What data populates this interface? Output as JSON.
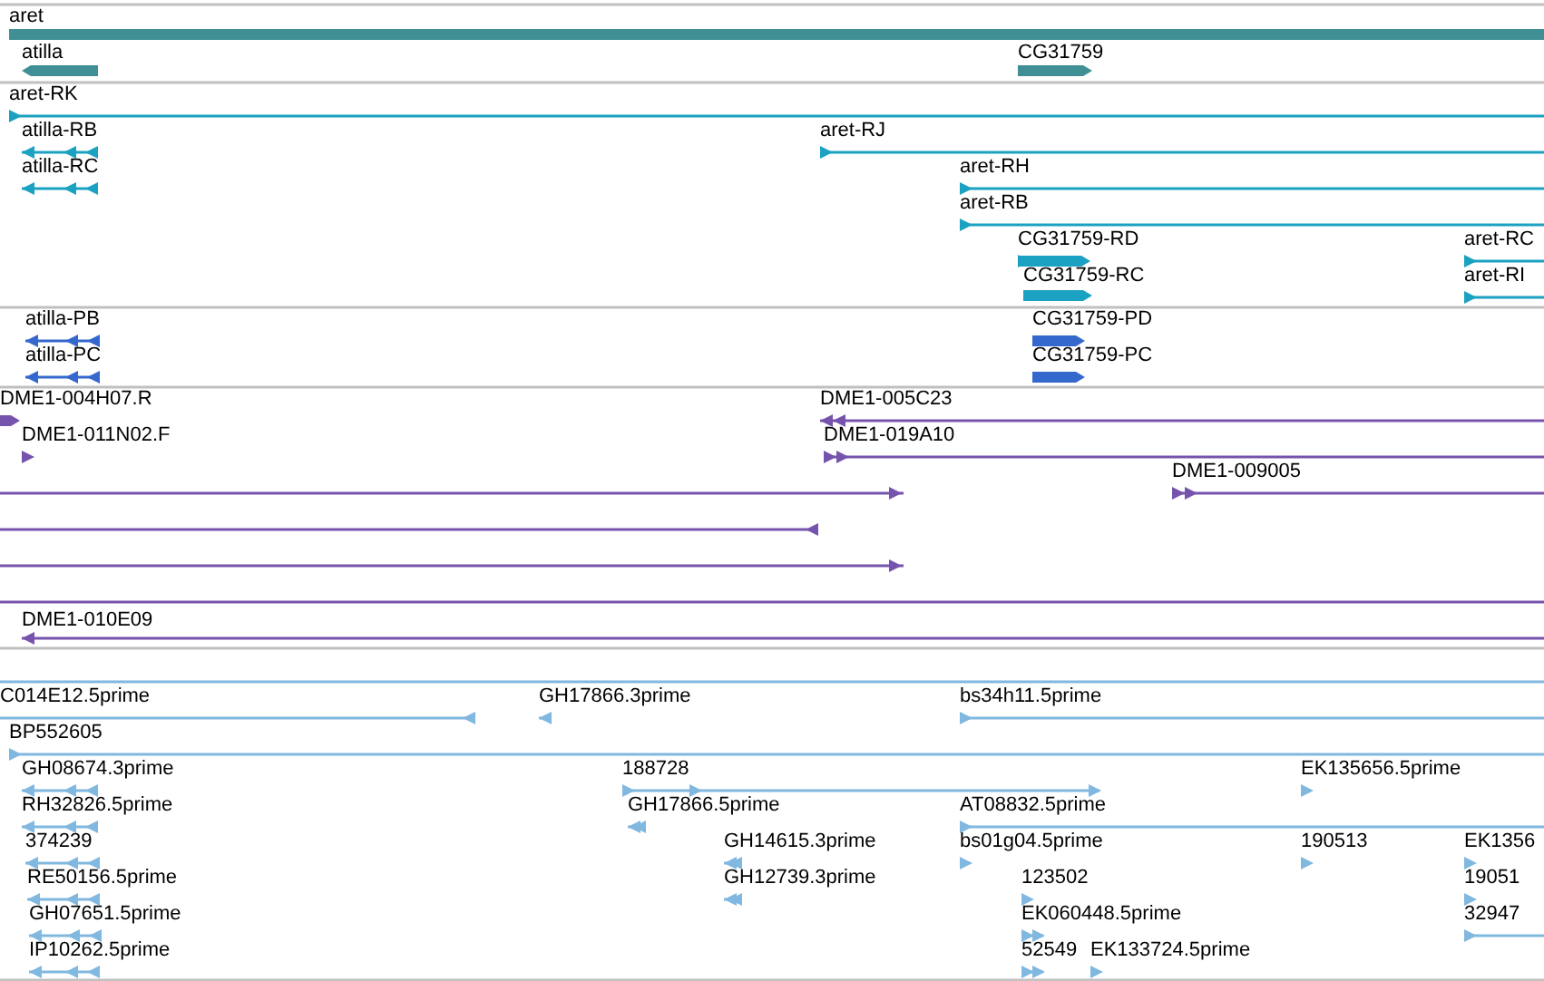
{
  "tracks": [
    {
      "color": "#3f8f94",
      "features": [
        {
          "label": "aret",
          "kind": "bar"
        },
        {
          "label": "atilla",
          "kind": "bar",
          "reverse": true
        },
        {
          "label": "CG31759",
          "kind": "bar",
          "reverse": false
        }
      ]
    },
    {
      "color": "#1ba1c1",
      "features": [
        {
          "label": "aret-RK",
          "kind": "line",
          "reverse": false
        },
        {
          "label": "atilla-RB",
          "kind": "line",
          "reverse": true
        },
        {
          "label": "aret-RJ",
          "kind": "line",
          "reverse": false
        },
        {
          "label": "atilla-RC",
          "kind": "line",
          "reverse": true
        },
        {
          "label": "aret-RH",
          "kind": "line",
          "reverse": false
        },
        {
          "label": "aret-RB",
          "kind": "line",
          "reverse": false
        },
        {
          "label": "CG31759-RD",
          "kind": "bar",
          "reverse": false
        },
        {
          "label": "aret-RC",
          "kind": "line",
          "reverse": false
        },
        {
          "label": "CG31759-RC",
          "kind": "bar",
          "reverse": false
        },
        {
          "label": "aret-RI",
          "kind": "line",
          "reverse": false
        }
      ]
    },
    {
      "color": "#3468cc",
      "features": [
        {
          "label": "atilla-PB",
          "kind": "line",
          "reverse": true
        },
        {
          "label": "CG31759-PD",
          "kind": "bar",
          "reverse": false
        },
        {
          "label": "atilla-PC",
          "kind": "line",
          "reverse": true
        },
        {
          "label": "CG31759-PC",
          "kind": "bar",
          "reverse": false
        }
      ]
    },
    {
      "color": "#7654ad",
      "features": [
        {
          "label": "DME1-004H07.R",
          "kind": "bar",
          "reverse": false
        },
        {
          "label": "DME1-005C23",
          "kind": "line",
          "reverse": true
        },
        {
          "label": "DME1-011N02.F",
          "kind": "line",
          "reverse": false
        },
        {
          "label": "DME1-019A10",
          "kind": "line",
          "reverse": false
        },
        {
          "kind": "line",
          "reverse": false
        },
        {
          "label": "DME1-009005",
          "kind": "line",
          "reverse": false
        },
        {
          "kind": "line",
          "reverse": true
        },
        {
          "kind": "line",
          "reverse": false
        },
        {
          "kind": "line"
        },
        {
          "label": "DME1-010E09",
          "kind": "line",
          "reverse": true
        }
      ]
    },
    {
      "color": "#80b8e0",
      "features": [
        {
          "kind": "line"
        },
        {
          "label": "C014E12.5prime",
          "kind": "line",
          "reverse": true
        },
        {
          "label": "GH17866.3prime",
          "kind": "line",
          "reverse": true
        },
        {
          "label": "bs34h11.5prime",
          "kind": "line",
          "reverse": false
        },
        {
          "label": "BP552605",
          "kind": "line",
          "reverse": false
        },
        {
          "label": "GH08674.3prime",
          "kind": "line",
          "reverse": true
        },
        {
          "label": "188728",
          "kind": "line",
          "reverse": false
        },
        {
          "label": "EK135656.5prime",
          "kind": "line",
          "reverse": false
        },
        {
          "label": "RH32826.5prime",
          "kind": "line",
          "reverse": true
        },
        {
          "label": "GH17866.5prime",
          "kind": "line",
          "reverse": true
        },
        {
          "label": "AT08832.5prime",
          "kind": "line",
          "reverse": false
        },
        {
          "label": "374239",
          "kind": "line",
          "reverse": true
        },
        {
          "label": "GH14615.3prime",
          "kind": "line",
          "reverse": true
        },
        {
          "label": "bs01g04.5prime",
          "kind": "line",
          "reverse": false
        },
        {
          "label": "190513",
          "kind": "line",
          "reverse": false
        },
        {
          "label": "EK1356",
          "kind": "line",
          "reverse": false
        },
        {
          "label": "RE50156.5prime",
          "kind": "line",
          "reverse": true
        },
        {
          "label": "GH12739.3prime",
          "kind": "line",
          "reverse": true
        },
        {
          "label": "123502",
          "kind": "line",
          "reverse": false
        },
        {
          "label": "19051",
          "kind": "line",
          "reverse": false
        },
        {
          "label": "GH07651.5prime",
          "kind": "line",
          "reverse": true
        },
        {
          "label": "EK060448.5prime",
          "kind": "line",
          "reverse": false
        },
        {
          "label": "32947",
          "kind": "line",
          "reverse": false
        },
        {
          "label": "IP10262.5prime",
          "kind": "line",
          "reverse": true
        },
        {
          "label": "52549",
          "kind": "line",
          "reverse": false
        },
        {
          "label": "EK133724.5prime",
          "kind": "line",
          "reverse": false
        }
      ]
    }
  ]
}
